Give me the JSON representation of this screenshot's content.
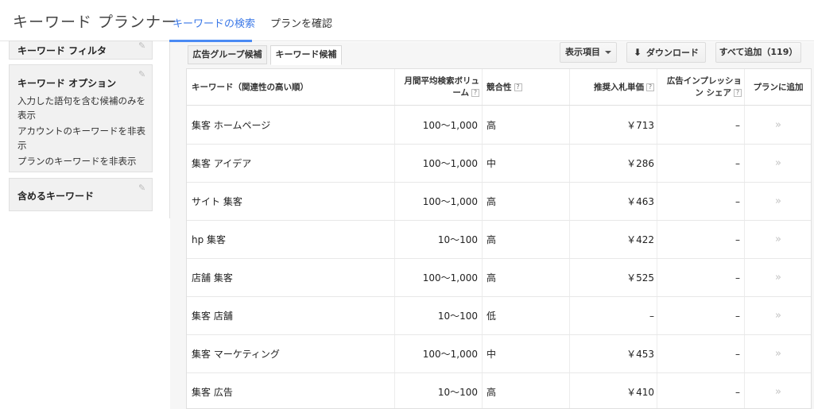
{
  "header": {
    "app_title": "キーワード プランナー",
    "tabs": [
      {
        "label": "キーワードの検索",
        "active": true
      },
      {
        "label": "プランを確認",
        "active": false
      }
    ]
  },
  "sidebar": {
    "filter_title": "キーワード フィルタ",
    "options_title": "キーワード オプション",
    "options": [
      "入力した語句を含む候補のみを表示",
      "アカウントのキーワードを非表示",
      "プランのキーワードを非表示"
    ],
    "include_title": "含めるキーワード"
  },
  "subtabs": [
    {
      "label": "広告グループ候補",
      "active": false
    },
    {
      "label": "キーワード候補",
      "active": true
    }
  ],
  "toolbar": {
    "columns_label": "表示項目",
    "download_label": "ダウンロード",
    "add_all_label": "すべて追加（119）"
  },
  "table": {
    "headers": {
      "keyword": "キーワード（関連性の高い順）",
      "volume_line1": "月間平均検索ボリュ",
      "volume_line2": "ーム",
      "competition": "競合性",
      "bid": "推奨入札単価",
      "impression_line1": "広告インプレッショ",
      "impression_line2": "ン シェア",
      "add": "プランに追加"
    },
    "rows": [
      {
        "keyword": "集客 ホームページ",
        "volume": "100〜1,000",
        "competition": "高",
        "bid": "￥713",
        "share": "–",
        "add": "»"
      },
      {
        "keyword": "集客 アイデア",
        "volume": "100〜1,000",
        "competition": "中",
        "bid": "￥286",
        "share": "–",
        "add": "»"
      },
      {
        "keyword": "サイト 集客",
        "volume": "100〜1,000",
        "competition": "高",
        "bid": "￥463",
        "share": "–",
        "add": "»"
      },
      {
        "keyword": "hp 集客",
        "volume": "10〜100",
        "competition": "高",
        "bid": "￥422",
        "share": "–",
        "add": "»"
      },
      {
        "keyword": "店舗 集客",
        "volume": "100〜1,000",
        "competition": "高",
        "bid": "￥525",
        "share": "–",
        "add": "»"
      },
      {
        "keyword": "集客 店舗",
        "volume": "10〜100",
        "competition": "低",
        "bid": "–",
        "share": "–",
        "add": "»"
      },
      {
        "keyword": "集客 マーケティング",
        "volume": "100〜1,000",
        "competition": "中",
        "bid": "￥453",
        "share": "–",
        "add": "»"
      },
      {
        "keyword": "集客 広告",
        "volume": "10〜100",
        "competition": "高",
        "bid": "￥410",
        "share": "–",
        "add": "»"
      }
    ]
  },
  "icons": {
    "question": "?",
    "pencil": "✎",
    "download": "⬇"
  },
  "colors": {
    "accent": "#3b78e7",
    "arrow": "#c4c4c4"
  }
}
